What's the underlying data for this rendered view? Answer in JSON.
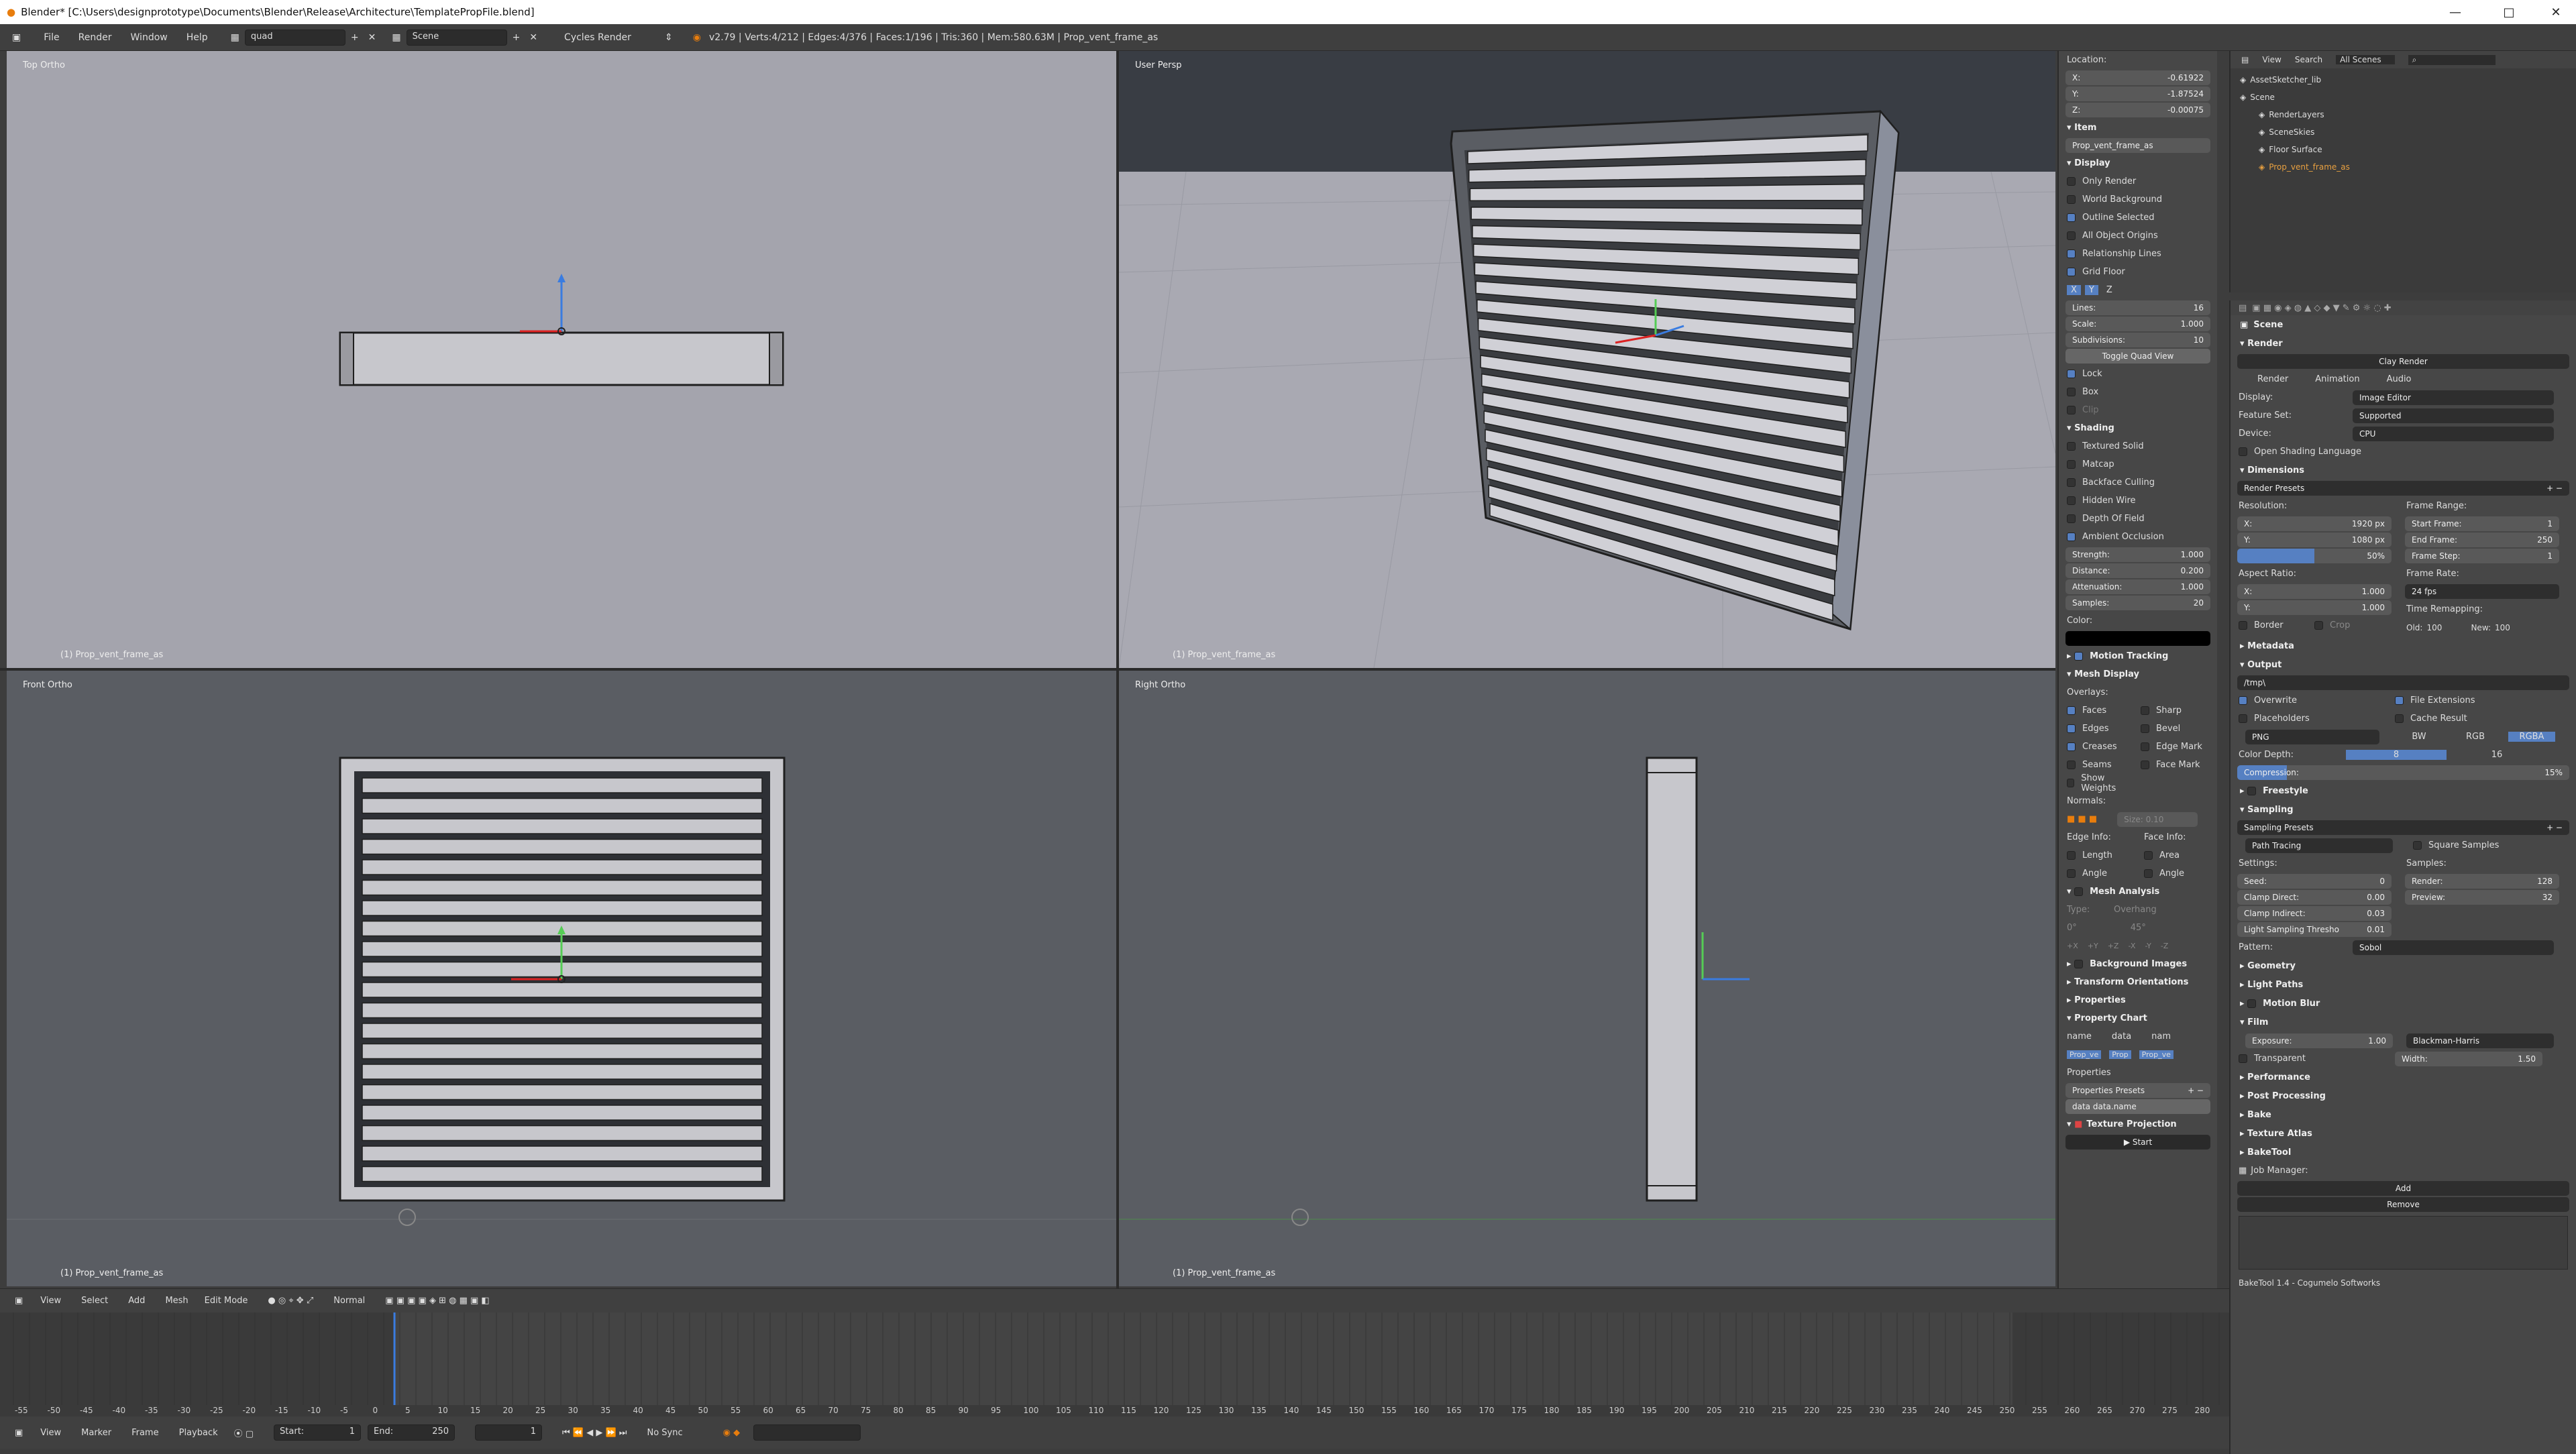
{
  "window": {
    "title": "Blender* [C:\\Users\\designprototype\\Documents\\Blender\\Release\\Architecture\\TemplatePropFile.blend]",
    "min": "—",
    "max": "□",
    "close": "✕"
  },
  "menubar": {
    "items": [
      "File",
      "Render",
      "Window",
      "Help"
    ],
    "layout": "quad",
    "scene": "Scene",
    "engine": "Cycles Render",
    "stats": "v2.79 | Verts:4/212 | Edges:4/376 | Faces:1/196 | Tris:360 | Mem:580.63M | Prop_vent_frame_as"
  },
  "viewports": {
    "top": {
      "label": "Top Ortho",
      "footer": "(1) Prop_vent_frame_as"
    },
    "persp": {
      "label": "User Persp",
      "footer": "(1) Prop_vent_frame_as"
    },
    "front": {
      "label": "Front Ortho",
      "footer": "(1) Prop_vent_frame_as"
    },
    "right": {
      "label": "Right Ortho",
      "footer": "(1) Prop_vent_frame_as"
    }
  },
  "npanel": {
    "location_label": "Location:",
    "x": "-0.61922",
    "y": "-1.87524",
    "z": "-0.00075",
    "item_header": "Item",
    "item_name": "Prop_vent_frame_as",
    "display_header": "Display",
    "display_checks": [
      {
        "label": "Only Render",
        "on": false
      },
      {
        "label": "World Background",
        "on": false
      },
      {
        "label": "Outline Selected",
        "on": true
      },
      {
        "label": "All Object Origins",
        "on": false
      },
      {
        "label": "Relationship Lines",
        "on": true
      },
      {
        "label": "Grid Floor",
        "on": true
      }
    ],
    "grid_axes": [
      "X",
      "Y",
      "Z"
    ],
    "lines": "16",
    "scale": "1.000",
    "subdivisions": "10",
    "toggle_quad": "Toggle Quad View",
    "lock": "Lock",
    "box": "Box",
    "clip": "Clip",
    "shading_header": "Shading",
    "shading_checks": [
      {
        "label": "Textured Solid",
        "on": false
      },
      {
        "label": "Matcap",
        "on": false
      },
      {
        "label": "Backface Culling",
        "on": false
      },
      {
        "label": "Hidden Wire",
        "on": false
      },
      {
        "label": "Depth Of Field",
        "on": false
      },
      {
        "label": "Ambient Occlusion",
        "on": true
      }
    ],
    "strength": "1.000",
    "distance": "0.200",
    "attenuation": "1.000",
    "samples": "20",
    "color_label": "Color:",
    "motion_tracking": "Motion Tracking",
    "mesh_display": "Mesh Display",
    "overlays": "Overlays:",
    "overlay_left": [
      "Faces",
      "Edges",
      "Creases",
      "Seams",
      "Show Weights"
    ],
    "overlay_right": [
      "Sharp",
      "Bevel",
      "Edge Mark",
      "Face Mark"
    ],
    "normals": "Normals:",
    "size": "Size: 0.10",
    "edge_info": "Edge Info:",
    "face_info": "Face Info:",
    "edge_items": [
      "Length",
      "Angle"
    ],
    "face_items": [
      "Area",
      "Angle"
    ],
    "mesh_analysis": "Mesh Analysis",
    "type_label": "Type:",
    "type_value": "Overhang",
    "analysis_vals": [
      "0°",
      "45°"
    ],
    "axis_btns": [
      "+X",
      "+Y",
      "+Z",
      "-X",
      "-Y",
      "-Z"
    ],
    "bg_images": "Background Images",
    "transform_orient": "Transform Orientations",
    "properties": "Properties",
    "property_chart": "Property Chart",
    "chart_cols": [
      "name",
      "data",
      "nam"
    ],
    "chart_vals": [
      "Prop_ve",
      "Prop",
      "Prop_ve"
    ],
    "properties2": "Properties",
    "props_presets": "Properties Presets",
    "data_field": "data data.name",
    "texture_proj": "Texture Projection",
    "start": "Start"
  },
  "outliner": {
    "tabs": [
      "View",
      "Search",
      "All Scenes"
    ],
    "items": [
      "AssetSketcher_lib",
      "Scene",
      "RenderLayers",
      "SceneSkies",
      "Floor Surface",
      "Prop_vent_frame_as"
    ]
  },
  "properties": {
    "context": "Scene",
    "render_header": "Render",
    "clay_render": "Clay Render",
    "buttons": [
      "Render",
      "Animation",
      "Audio"
    ],
    "display_label": "Display:",
    "display_value": "Image Editor",
    "feature_label": "Feature Set:",
    "feature_value": "Supported",
    "device_label": "Device:",
    "device_value": "CPU",
    "osl": "Open Shading Language",
    "dimensions": "Dimensions",
    "render_presets": "Render Presets",
    "resolution": "Resolution:",
    "res_x": "1920 px",
    "res_y": "1080 px",
    "res_pct": "50%",
    "frame_range": "Frame Range:",
    "start_frame": "1",
    "end_frame": "250",
    "frame_step": "1",
    "aspect": "Aspect Ratio:",
    "asp_x": "1.000",
    "asp_y": "1.000",
    "frame_rate": "Frame Rate:",
    "fps": "24 fps",
    "time_remap": "Time Remapping:",
    "old": "100",
    "new": "100",
    "border": "Border",
    "crop": "Crop",
    "metadata": "Metadata",
    "output": "Output",
    "output_path": "/tmp\\",
    "overwrite": "Overwrite",
    "file_ext": "File Extensions",
    "placeholders": "Placeholders",
    "cache": "Cache Result",
    "format": "PNG",
    "bw": "BW",
    "rgb": "RGB",
    "rgba": "RGBA",
    "color_depth": "Color Depth:",
    "depth8": "8",
    "depth16": "16",
    "compression": "Compression:",
    "compression_val": "15%",
    "freestyle": "Freestyle",
    "sampling": "Sampling",
    "sampling_presets": "Sampling Presets",
    "path_tracing": "Path Tracing",
    "square_samples": "Square Samples",
    "settings": "Settings:",
    "samples": "Samples:",
    "seed": "0",
    "clamp_direct": "0.00",
    "clamp_indirect": "0.03",
    "light_thresh": "0.01",
    "render_samples": "128",
    "preview_samples": "32",
    "pattern_label": "Pattern:",
    "pattern": "Sobol",
    "panels": [
      "Geometry",
      "Light Paths",
      "Motion Blur"
    ],
    "film": "Film",
    "exposure": "1.00",
    "filter": "Blackman-Harris",
    "transparent": "Transparent",
    "width": "1.50",
    "panels2": [
      "Performance",
      "Post Processing",
      "Bake",
      "Texture Atlas",
      "BakeTool"
    ],
    "job_manager": "Job Manager:",
    "add": "Add",
    "remove": "Remove",
    "footer": "BakeTool 1.4 - Cogumelo Softworks"
  },
  "vpheader": {
    "items": [
      "View",
      "Select",
      "Add",
      "Mesh"
    ],
    "mode": "Edit Mode",
    "orientation": "Normal"
  },
  "timeline": {
    "ticks": [
      "-55",
      "-50",
      "-45",
      "-40",
      "-35",
      "-30",
      "-25",
      "-20",
      "-15",
      "-10",
      "-5",
      "0",
      "5",
      "10",
      "15",
      "20",
      "25",
      "30",
      "35",
      "40",
      "45",
      "50",
      "55",
      "60",
      "65",
      "70",
      "75",
      "80",
      "85",
      "90",
      "95",
      "100",
      "105",
      "110",
      "115",
      "120",
      "125",
      "130",
      "135",
      "140",
      "145",
      "150",
      "155",
      "160",
      "165",
      "170",
      "175",
      "180",
      "185",
      "190",
      "195",
      "200",
      "205",
      "210",
      "215",
      "220",
      "225",
      "230",
      "235",
      "240",
      "245",
      "250",
      "255",
      "260",
      "265",
      "270",
      "275",
      "280"
    ],
    "menu": [
      "View",
      "Marker",
      "Frame",
      "Playback"
    ],
    "start": "Start:",
    "start_val": "1",
    "end": "End:",
    "end_val": "250",
    "current": "1",
    "sync": "No Sync"
  }
}
